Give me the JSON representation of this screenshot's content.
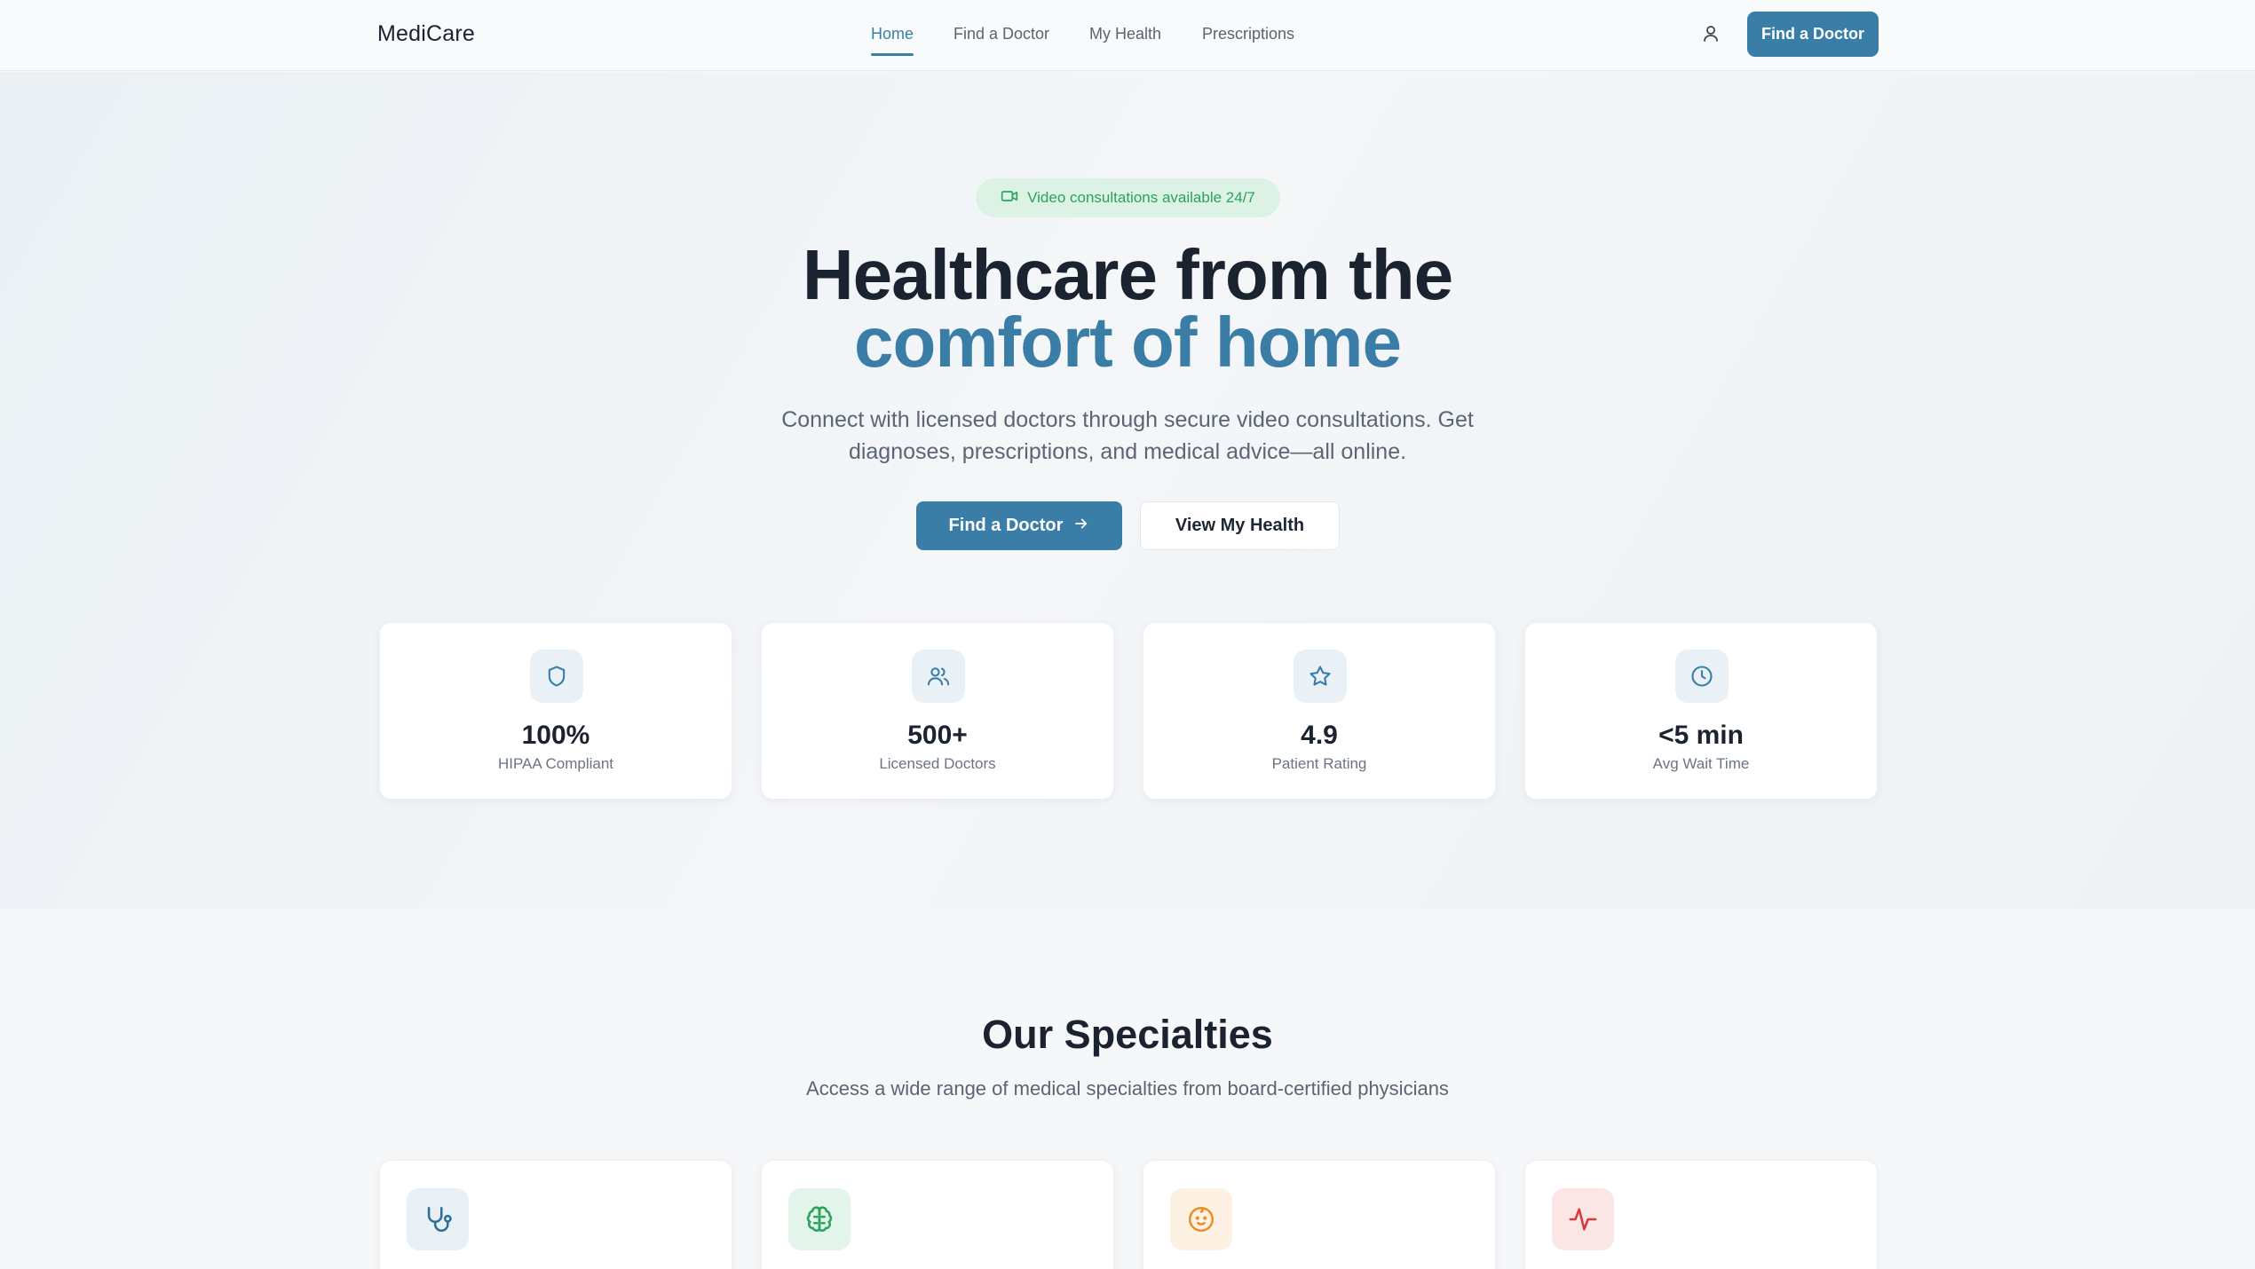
{
  "header": {
    "brand": "MediCare",
    "nav": [
      {
        "label": "Home",
        "active": true
      },
      {
        "label": "Find a Doctor",
        "active": false
      },
      {
        "label": "My Health",
        "active": false
      },
      {
        "label": "Prescriptions",
        "active": false
      }
    ],
    "user_icon": "user-icon",
    "cta_label": "Find a Doctor"
  },
  "hero": {
    "badge_icon": "video-icon",
    "badge_text": "Video consultations available 24/7",
    "title_line1": "Healthcare from the",
    "title_line2": "comfort of home",
    "subtitle": "Connect with licensed doctors through secure video consultations. Get diagnoses, prescriptions, and medical advice—all online.",
    "primary_button": "Find a Doctor",
    "primary_button_icon": "arrow-right-icon",
    "secondary_button": "View My Health"
  },
  "stats": [
    {
      "icon": "shield-icon",
      "value": "100%",
      "label": "HIPAA Compliant"
    },
    {
      "icon": "users-icon",
      "value": "500+",
      "label": "Licensed Doctors"
    },
    {
      "icon": "star-icon",
      "value": "4.9",
      "label": "Patient Rating"
    },
    {
      "icon": "clock-icon",
      "value": "<5 min",
      "label": "Avg Wait Time"
    }
  ],
  "specialties": {
    "title": "Our Specialties",
    "subtitle": "Access a wide range of medical specialties from board-certified physicians",
    "cards": [
      {
        "icon": "stethoscope-icon",
        "color": "#2f6f96",
        "bg": "#e9f0f5"
      },
      {
        "icon": "brain-icon",
        "color": "#2ba35c",
        "bg": "#e3f4ea"
      },
      {
        "icon": "baby-icon",
        "color": "#e8912b",
        "bg": "#fdf1e3"
      },
      {
        "icon": "heart-pulse-icon",
        "color": "#d63a3a",
        "bg": "#fbe6e6"
      }
    ]
  },
  "colors": {
    "accent": "#3a7ea8",
    "badge_green": "#2ba35c",
    "text_dark": "#1c2330",
    "text_muted": "#5c6573"
  }
}
